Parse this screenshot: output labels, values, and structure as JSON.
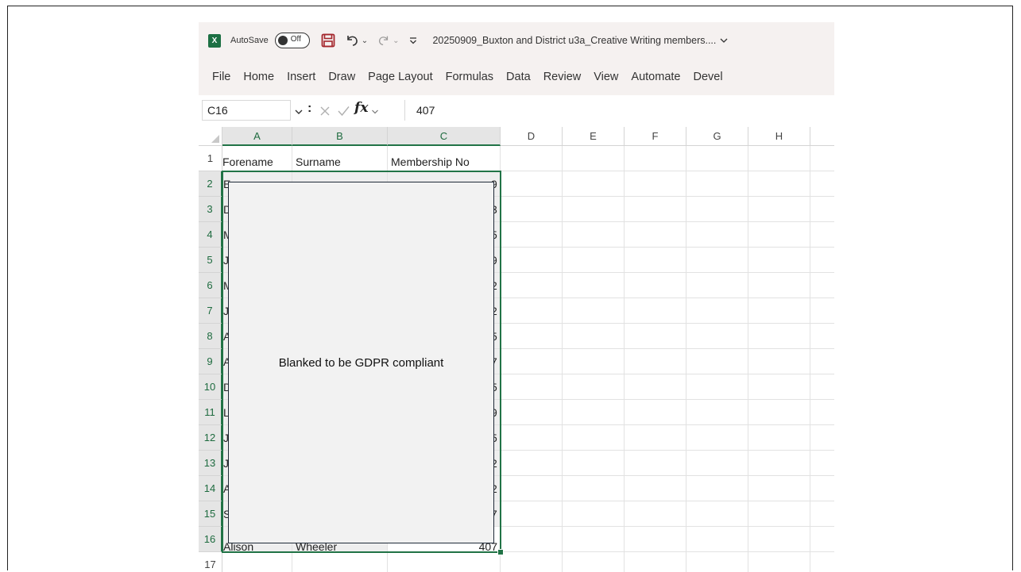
{
  "titlebar": {
    "app_icon_letter": "X",
    "autosave_label": "AutoSave",
    "autosave_state": "Off",
    "document_title": "20250909_Buxton and District u3a_Creative Writing members...."
  },
  "ribbon": {
    "tabs": [
      "File",
      "Home",
      "Insert",
      "Draw",
      "Page Layout",
      "Formulas",
      "Data",
      "Review",
      "View",
      "Automate",
      "Devel"
    ]
  },
  "formula_bar": {
    "name_box": "C16",
    "fx_label": "fx",
    "value": "407",
    "dots": ":"
  },
  "grid": {
    "columns": [
      "A",
      "B",
      "C",
      "D",
      "E",
      "F",
      "G",
      "H"
    ],
    "selected_columns": [
      "A",
      "B",
      "C"
    ],
    "rows": [
      "1",
      "2",
      "3",
      "4",
      "5",
      "6",
      "7",
      "8",
      "9",
      "10",
      "11",
      "12",
      "13",
      "14",
      "15",
      "16",
      "17"
    ],
    "header_row": [
      "Forename",
      "Surname",
      "Membership No"
    ],
    "visible_col_a_first_chars": [
      "E",
      "D",
      "M",
      "J",
      "M",
      "J",
      "A",
      "A",
      "D",
      "L",
      "J",
      "J",
      "A",
      "S"
    ],
    "visible_col_c_last_digits": [
      "9",
      "3",
      "5",
      "9",
      "2",
      "2",
      "5",
      "7",
      "5",
      "9",
      "5",
      "2",
      "2",
      "7"
    ],
    "row16": {
      "forename_partial": "Alison",
      "surname_partial": "Wheeler",
      "membership_partial": "407"
    }
  },
  "overlay": {
    "text": "Blanked to be GDPR compliant"
  },
  "colors": {
    "excel_green": "#217346",
    "titlebar_bg": "#f5f1f0",
    "overlay_bg": "#f2f2f2"
  }
}
